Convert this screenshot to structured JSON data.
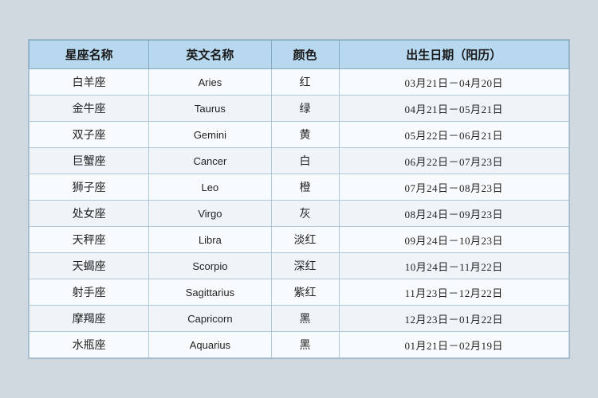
{
  "table": {
    "headers": [
      "星座名称",
      "英文名称",
      "颜色",
      "出生日期（阳历）"
    ],
    "rows": [
      {
        "zh": "白羊座",
        "en": "Aries",
        "color": "红",
        "dates": "03月21日－04月20日"
      },
      {
        "zh": "金牛座",
        "en": "Taurus",
        "color": "绿",
        "dates": "04月21日－05月21日"
      },
      {
        "zh": "双子座",
        "en": "Gemini",
        "color": "黄",
        "dates": "05月22日－06月21日"
      },
      {
        "zh": "巨蟹座",
        "en": "Cancer",
        "color": "白",
        "dates": "06月22日－07月23日"
      },
      {
        "zh": "狮子座",
        "en": "Leo",
        "color": "橙",
        "dates": "07月24日－08月23日"
      },
      {
        "zh": "处女座",
        "en": "Virgo",
        "color": "灰",
        "dates": "08月24日－09月23日"
      },
      {
        "zh": "天秤座",
        "en": "Libra",
        "color": "淡红",
        "dates": "09月24日－10月23日"
      },
      {
        "zh": "天蝎座",
        "en": "Scorpio",
        "color": "深红",
        "dates": "10月24日－11月22日"
      },
      {
        "zh": "射手座",
        "en": "Sagittarius",
        "color": "紫红",
        "dates": "11月23日－12月22日"
      },
      {
        "zh": "摩羯座",
        "en": "Capricorn",
        "color": "黑",
        "dates": "12月23日－01月22日"
      },
      {
        "zh": "水瓶座",
        "en": "Aquarius",
        "color": "黑",
        "dates": "01月21日－02月19日"
      }
    ]
  }
}
